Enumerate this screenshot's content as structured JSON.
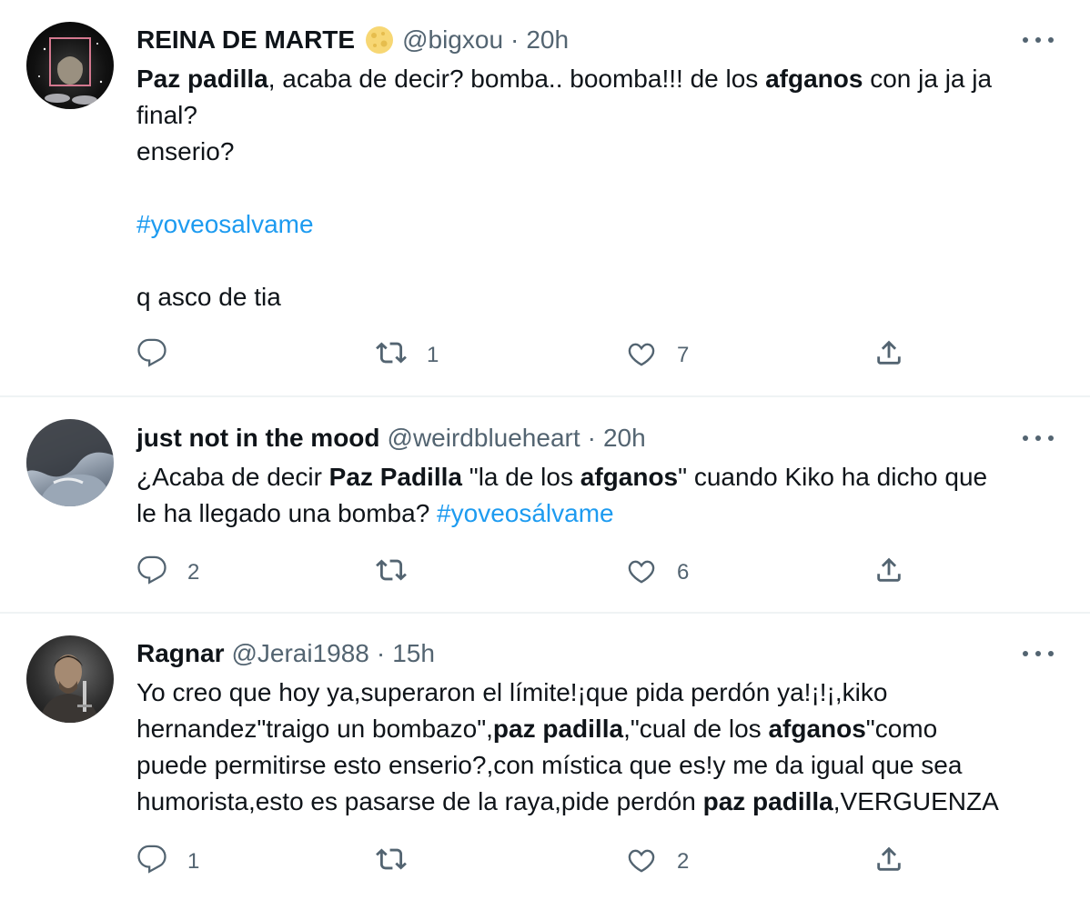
{
  "tweets": [
    {
      "name": "REINA DE MARTE",
      "handle": "@bigxou",
      "sep": "·",
      "time": "20h",
      "lines": [
        [
          {
            "t": "Paz padilla",
            "s": "b"
          },
          {
            "t": ", acaba de decir? bomba.. boomba!!! de los "
          },
          {
            "t": "afganos",
            "s": "b"
          },
          {
            "t": " con ja ja ja"
          }
        ],
        [
          {
            "t": "final?"
          }
        ],
        [
          {
            "t": "enserio?"
          }
        ],
        [],
        [
          {
            "t": "#yoveosalvame",
            "s": "tag"
          }
        ],
        [],
        [
          {
            "t": "q asco de tia"
          }
        ]
      ],
      "replies": "",
      "retweets": "1",
      "likes": "7"
    },
    {
      "name": "just not in the mood",
      "handle": "@weirdblueheart",
      "sep": "·",
      "time": "20h",
      "lines": [
        [
          {
            "t": "¿Acaba de decir "
          },
          {
            "t": "Paz Padilla",
            "s": "b"
          },
          {
            "t": " \"la de los "
          },
          {
            "t": "afganos",
            "s": "b"
          },
          {
            "t": "\" cuando Kiko ha dicho que"
          }
        ],
        [
          {
            "t": "le ha llegado una bomba? "
          },
          {
            "t": "#yoveosálvame",
            "s": "tag"
          }
        ]
      ],
      "replies": "2",
      "retweets": "",
      "likes": "6"
    },
    {
      "name": "Ragnar",
      "handle": "@Jerai1988",
      "sep": "·",
      "time": "15h",
      "lines": [
        [
          {
            "t": "Yo creo que hoy ya,superaron el límite!¡que pida perdón ya!¡!¡,kiko"
          }
        ],
        [
          {
            "t": "hernandez\"traigo un bombazo\","
          },
          {
            "t": "paz padilla",
            "s": "b"
          },
          {
            "t": ",\"cual de los "
          },
          {
            "t": "afganos",
            "s": "b"
          },
          {
            "t": "\"como"
          }
        ],
        [
          {
            "t": "puede permitirse esto enserio?,con mística que es!y me da igual que sea"
          }
        ],
        [
          {
            "t": "humorista,esto es pasarse de la raya,pide perdón "
          },
          {
            "t": "paz padilla",
            "s": "b"
          },
          {
            "t": ",VERGUENZA"
          }
        ]
      ],
      "replies": "1",
      "retweets": "",
      "likes": "2"
    }
  ],
  "icons": {
    "reply": "reply-icon",
    "retweet": "retweet-icon",
    "like": "heart-icon",
    "share": "share-icon",
    "more": "more-icon",
    "verified": "moon-emoji-icon"
  },
  "colors": {
    "link": "#1d9bf0",
    "secondary": "#536471",
    "text": "#0f1419",
    "divider": "#eff3f4"
  }
}
